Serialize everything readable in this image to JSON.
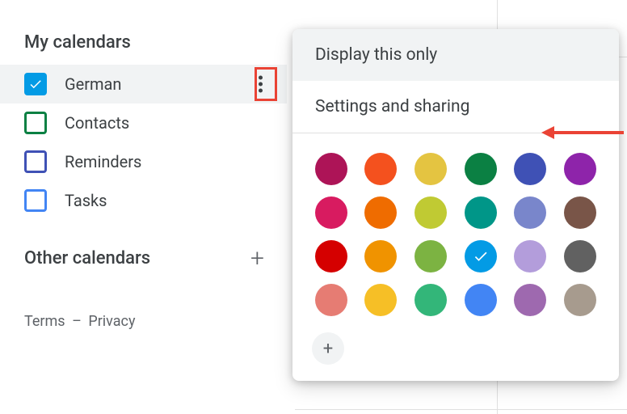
{
  "sidebar": {
    "my_calendars_title": "My calendars",
    "items": [
      {
        "label": "German",
        "checked": true,
        "color": "#039be5",
        "active": true
      },
      {
        "label": "Contacts",
        "checked": false,
        "color": "#0b8043"
      },
      {
        "label": "Reminders",
        "checked": false,
        "color": "#3f51b5"
      },
      {
        "label": "Tasks",
        "checked": false,
        "color": "#4285f4"
      }
    ],
    "other_calendars_title": "Other calendars"
  },
  "footer": {
    "terms": "Terms",
    "separator": "–",
    "privacy": "Privacy"
  },
  "popup": {
    "display_only": "Display this only",
    "settings_sharing": "Settings and sharing",
    "colors": [
      "#ad1457",
      "#f4511e",
      "#e4c441",
      "#0b8043",
      "#3f51b5",
      "#8e24aa",
      "#d81b60",
      "#ef6c00",
      "#c0ca33",
      "#009688",
      "#7986cb",
      "#795548",
      "#d50000",
      "#f09300",
      "#7cb342",
      "#039be5",
      "#b39ddb",
      "#616161",
      "#e67c73",
      "#f6bf26",
      "#33b679",
      "#4285f4",
      "#9e69af",
      "#a79b8e"
    ],
    "selected_color_index": 15
  }
}
